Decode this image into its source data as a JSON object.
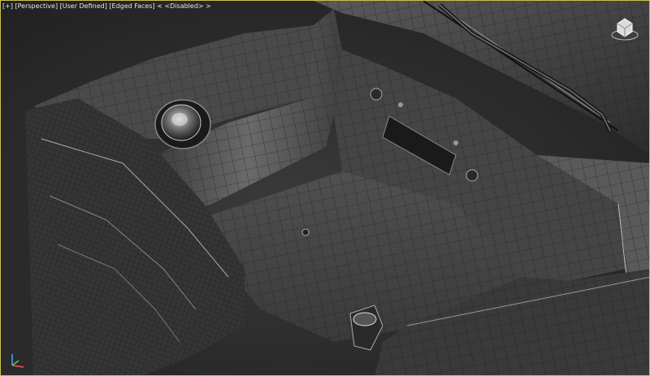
{
  "viewport": {
    "label": {
      "plus": "[+]",
      "view": "[Perspective]",
      "shading": "[User Defined]",
      "edges": "[Edged Faces]",
      "mode": "< <Disabled> >"
    },
    "border_color": "#c9c24a",
    "background_color": "#2b2b2b"
  },
  "icons": {
    "viewcube": "viewcube-home-icon",
    "axis": "axis-tripod-icon"
  }
}
